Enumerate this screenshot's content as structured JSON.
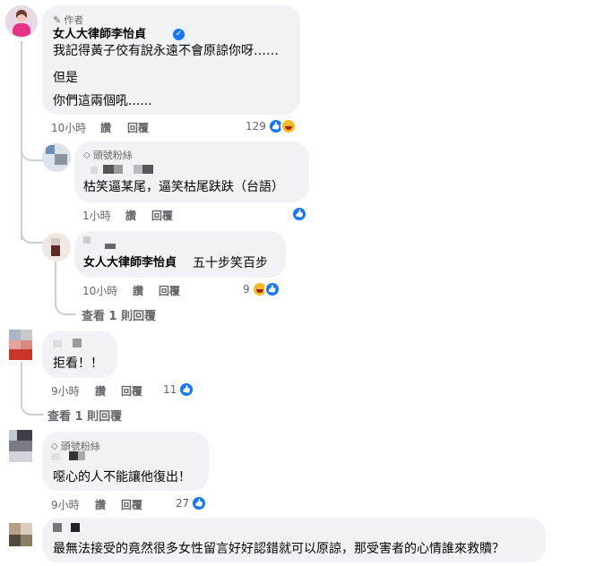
{
  "colors": {
    "accent": "#1877f2",
    "bubble": "#f0f2f5",
    "muted": "#65676b",
    "haha": "#f7b928"
  },
  "c1": {
    "badge": "作者",
    "name": "女人大律師李怡貞",
    "lines": [
      "我記得黃子佼有說永遠不會原諒你呀……",
      "但是",
      "你們這兩個吼......"
    ],
    "time": "10小時",
    "like": "讚",
    "reply": "回覆",
    "count": "129"
  },
  "r1": {
    "badge": "頭號粉絲",
    "text": "枯笑逼某尾，逼笑枯尾趺趺（台語）",
    "time": "1小時",
    "like": "讚",
    "reply": "回覆"
  },
  "r2": {
    "name": "女人大律師李怡貞",
    "text": "五十步笑百步",
    "time": "10小時",
    "like": "讚",
    "reply": "回覆",
    "count": "9",
    "view_replies": "查看 1 則回覆"
  },
  "c2": {
    "text": "拒看！！",
    "time": "9小時",
    "like": "讚",
    "reply": "回覆",
    "count": "11",
    "view_replies": "查看 1 則回覆"
  },
  "c3": {
    "badge": "頭號粉絲",
    "text": "噁心的人不能讓他復出！",
    "time": "9小時",
    "like": "讚",
    "reply": "回覆",
    "count": "27"
  },
  "c4": {
    "text": "最無法接受的竟然很多女性留言好好認錯就可以原諒，那受害者的心情誰來救贖？"
  }
}
